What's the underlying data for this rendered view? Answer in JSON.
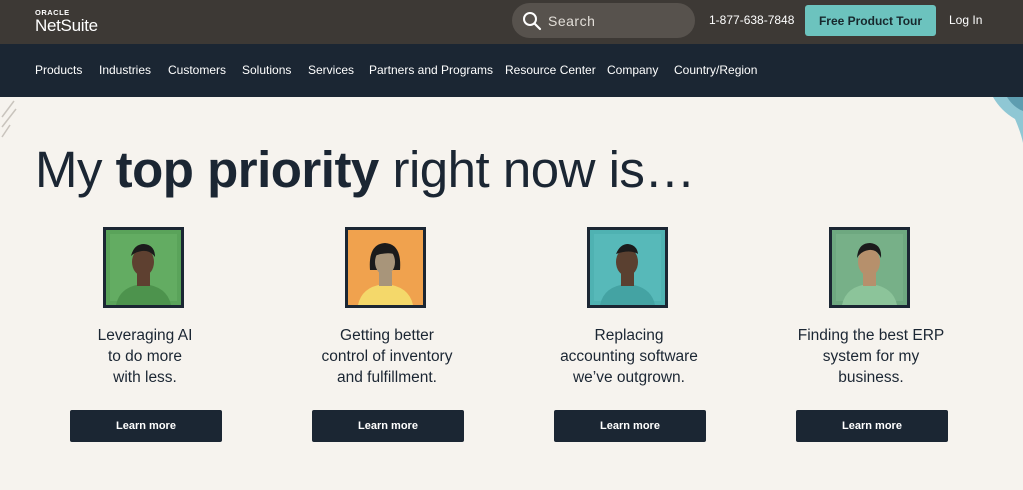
{
  "header": {
    "logo_top": "ORACLE",
    "logo_main": "NetSuite",
    "search_placeholder": "Search",
    "search_icon": "search-icon",
    "phone": "1-877-638-7848",
    "tour_label": "Free Product Tour",
    "login_label": "Log In"
  },
  "nav": {
    "items": [
      "Products",
      "Industries",
      "Customers",
      "Solutions",
      "Services",
      "Partners and Programs",
      "Resource Center",
      "Company",
      "Country/Region"
    ]
  },
  "hero": {
    "headline_prefix": "My",
    "headline_bold": "top priority",
    "headline_suffix": "right now is…"
  },
  "cards": [
    {
      "lines": [
        "Leveraging AI",
        "to do more",
        "with less."
      ],
      "button": "Learn more",
      "bg": "#5aa35a",
      "skin": "#5e4030",
      "shirt": "#5aa35a"
    },
    {
      "lines": [
        "Getting better",
        "control of inventory",
        "and fulfillment."
      ],
      "button": "Learn more",
      "bg": "#f0a24e",
      "skin": "#a8957a",
      "shirt": "#f4d86a"
    },
    {
      "lines": [
        "Replacing",
        "accounting software",
        "we’ve outgrown."
      ],
      "button": "Learn more",
      "bg": "#4fb2b2",
      "skin": "#5a4030",
      "shirt": "#4fb2b2"
    },
    {
      "lines": [
        "Finding the best ERP",
        "system for my",
        "business."
      ],
      "button": "Learn more",
      "bg": "#6ea880",
      "skin": "#b6906c",
      "shirt": "#8cc49a"
    }
  ],
  "colors": {
    "nav_bg": "#1b2633",
    "top_bg": "#3d3935",
    "accent": "#6cc3be",
    "page_bg": "#f6f3ee"
  }
}
